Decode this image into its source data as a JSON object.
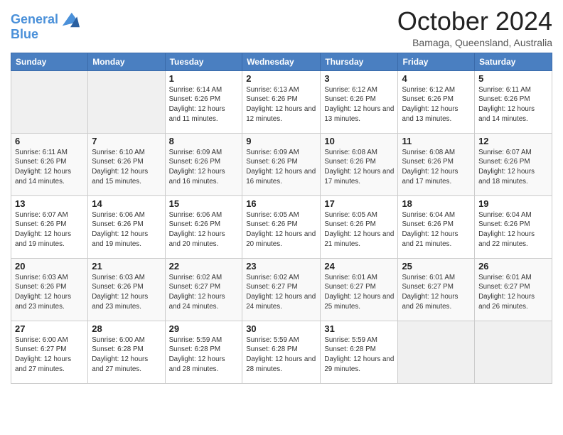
{
  "header": {
    "logo_line1": "General",
    "logo_line2": "Blue",
    "month": "October 2024",
    "location": "Bamaga, Queensland, Australia"
  },
  "weekdays": [
    "Sunday",
    "Monday",
    "Tuesday",
    "Wednesday",
    "Thursday",
    "Friday",
    "Saturday"
  ],
  "weeks": [
    [
      {
        "day": "",
        "info": ""
      },
      {
        "day": "",
        "info": ""
      },
      {
        "day": "1",
        "info": "Sunrise: 6:14 AM\nSunset: 6:26 PM\nDaylight: 12 hours and 11 minutes."
      },
      {
        "day": "2",
        "info": "Sunrise: 6:13 AM\nSunset: 6:26 PM\nDaylight: 12 hours and 12 minutes."
      },
      {
        "day": "3",
        "info": "Sunrise: 6:12 AM\nSunset: 6:26 PM\nDaylight: 12 hours and 13 minutes."
      },
      {
        "day": "4",
        "info": "Sunrise: 6:12 AM\nSunset: 6:26 PM\nDaylight: 12 hours and 13 minutes."
      },
      {
        "day": "5",
        "info": "Sunrise: 6:11 AM\nSunset: 6:26 PM\nDaylight: 12 hours and 14 minutes."
      }
    ],
    [
      {
        "day": "6",
        "info": "Sunrise: 6:11 AM\nSunset: 6:26 PM\nDaylight: 12 hours and 14 minutes."
      },
      {
        "day": "7",
        "info": "Sunrise: 6:10 AM\nSunset: 6:26 PM\nDaylight: 12 hours and 15 minutes."
      },
      {
        "day": "8",
        "info": "Sunrise: 6:09 AM\nSunset: 6:26 PM\nDaylight: 12 hours and 16 minutes."
      },
      {
        "day": "9",
        "info": "Sunrise: 6:09 AM\nSunset: 6:26 PM\nDaylight: 12 hours and 16 minutes."
      },
      {
        "day": "10",
        "info": "Sunrise: 6:08 AM\nSunset: 6:26 PM\nDaylight: 12 hours and 17 minutes."
      },
      {
        "day": "11",
        "info": "Sunrise: 6:08 AM\nSunset: 6:26 PM\nDaylight: 12 hours and 17 minutes."
      },
      {
        "day": "12",
        "info": "Sunrise: 6:07 AM\nSunset: 6:26 PM\nDaylight: 12 hours and 18 minutes."
      }
    ],
    [
      {
        "day": "13",
        "info": "Sunrise: 6:07 AM\nSunset: 6:26 PM\nDaylight: 12 hours and 19 minutes."
      },
      {
        "day": "14",
        "info": "Sunrise: 6:06 AM\nSunset: 6:26 PM\nDaylight: 12 hours and 19 minutes."
      },
      {
        "day": "15",
        "info": "Sunrise: 6:06 AM\nSunset: 6:26 PM\nDaylight: 12 hours and 20 minutes."
      },
      {
        "day": "16",
        "info": "Sunrise: 6:05 AM\nSunset: 6:26 PM\nDaylight: 12 hours and 20 minutes."
      },
      {
        "day": "17",
        "info": "Sunrise: 6:05 AM\nSunset: 6:26 PM\nDaylight: 12 hours and 21 minutes."
      },
      {
        "day": "18",
        "info": "Sunrise: 6:04 AM\nSunset: 6:26 PM\nDaylight: 12 hours and 21 minutes."
      },
      {
        "day": "19",
        "info": "Sunrise: 6:04 AM\nSunset: 6:26 PM\nDaylight: 12 hours and 22 minutes."
      }
    ],
    [
      {
        "day": "20",
        "info": "Sunrise: 6:03 AM\nSunset: 6:26 PM\nDaylight: 12 hours and 23 minutes."
      },
      {
        "day": "21",
        "info": "Sunrise: 6:03 AM\nSunset: 6:26 PM\nDaylight: 12 hours and 23 minutes."
      },
      {
        "day": "22",
        "info": "Sunrise: 6:02 AM\nSunset: 6:27 PM\nDaylight: 12 hours and 24 minutes."
      },
      {
        "day": "23",
        "info": "Sunrise: 6:02 AM\nSunset: 6:27 PM\nDaylight: 12 hours and 24 minutes."
      },
      {
        "day": "24",
        "info": "Sunrise: 6:01 AM\nSunset: 6:27 PM\nDaylight: 12 hours and 25 minutes."
      },
      {
        "day": "25",
        "info": "Sunrise: 6:01 AM\nSunset: 6:27 PM\nDaylight: 12 hours and 26 minutes."
      },
      {
        "day": "26",
        "info": "Sunrise: 6:01 AM\nSunset: 6:27 PM\nDaylight: 12 hours and 26 minutes."
      }
    ],
    [
      {
        "day": "27",
        "info": "Sunrise: 6:00 AM\nSunset: 6:27 PM\nDaylight: 12 hours and 27 minutes."
      },
      {
        "day": "28",
        "info": "Sunrise: 6:00 AM\nSunset: 6:28 PM\nDaylight: 12 hours and 27 minutes."
      },
      {
        "day": "29",
        "info": "Sunrise: 5:59 AM\nSunset: 6:28 PM\nDaylight: 12 hours and 28 minutes."
      },
      {
        "day": "30",
        "info": "Sunrise: 5:59 AM\nSunset: 6:28 PM\nDaylight: 12 hours and 28 minutes."
      },
      {
        "day": "31",
        "info": "Sunrise: 5:59 AM\nSunset: 6:28 PM\nDaylight: 12 hours and 29 minutes."
      },
      {
        "day": "",
        "info": ""
      },
      {
        "day": "",
        "info": ""
      }
    ]
  ]
}
